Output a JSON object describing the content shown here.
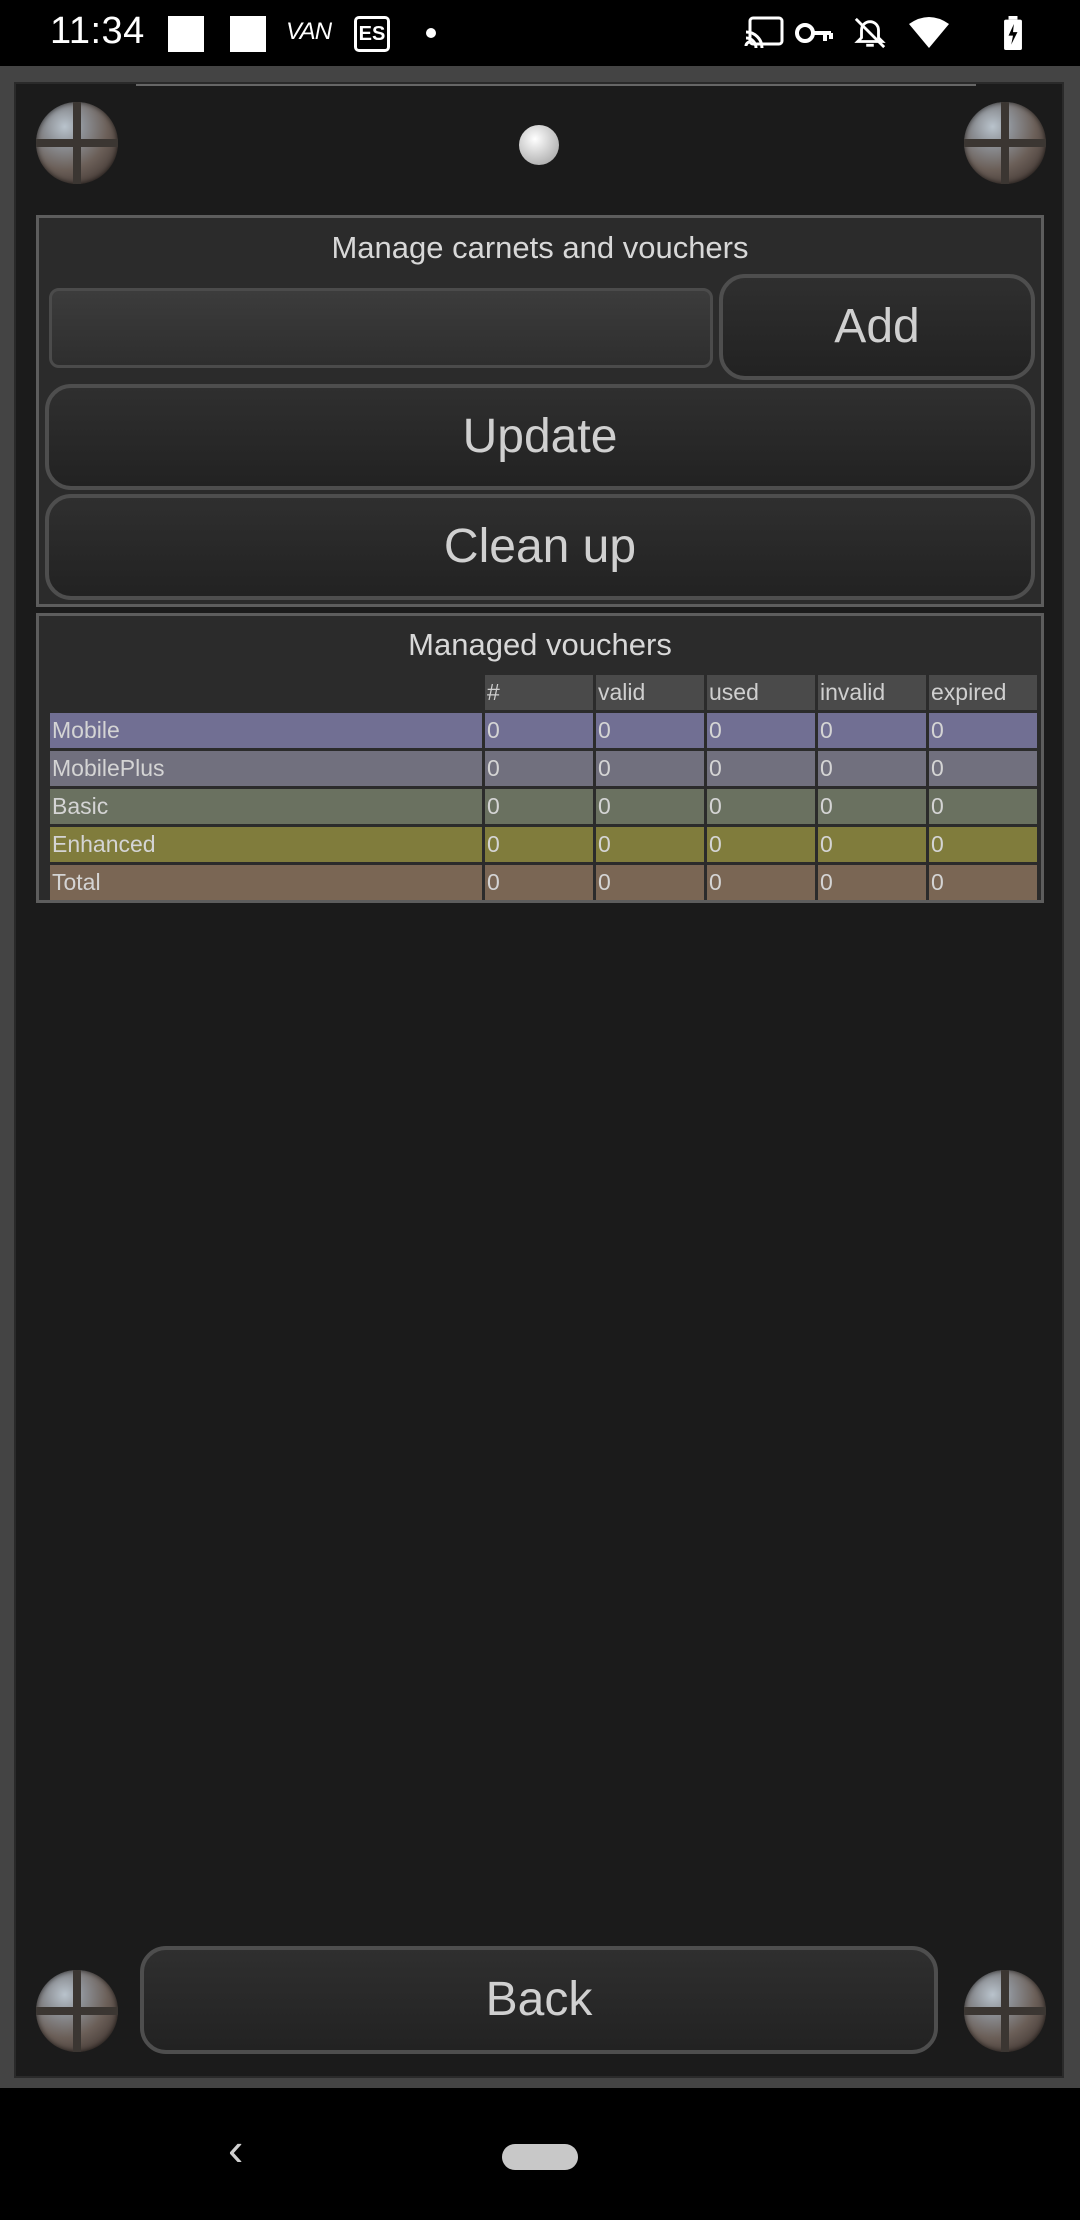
{
  "status_bar": {
    "time": "11:34",
    "carrier_label": "VAN",
    "es_badge": "ES",
    "icons": [
      "square-icon",
      "square-icon",
      "van-icon",
      "es-icon",
      "dot-icon",
      "cast-icon",
      "vpn-key-icon",
      "alarm-off-icon",
      "wifi-icon",
      "battery-charging-icon"
    ]
  },
  "manage": {
    "title": "Manage carnets and vouchers",
    "input_value": "",
    "input_placeholder": "",
    "add_label": "Add",
    "update_label": "Update",
    "cleanup_label": "Clean up"
  },
  "vouchers": {
    "title": "Managed vouchers",
    "columns": [
      "#",
      "valid",
      "used",
      "invalid",
      "expired"
    ],
    "rows": [
      {
        "name": "Mobile",
        "values": [
          "0",
          "0",
          "0",
          "0",
          "0"
        ],
        "color": "#716f93"
      },
      {
        "name": "MobilePlus",
        "values": [
          "0",
          "0",
          "0",
          "0",
          "0"
        ],
        "color": "#71707e"
      },
      {
        "name": "Basic",
        "values": [
          "0",
          "0",
          "0",
          "0",
          "0"
        ],
        "color": "#6a7160"
      },
      {
        "name": "Enhanced",
        "values": [
          "0",
          "0",
          "0",
          "0",
          "0"
        ],
        "color": "#807c3c"
      },
      {
        "name": "Total",
        "values": [
          "0",
          "0",
          "0",
          "0",
          "0"
        ],
        "color": "#7a6654"
      }
    ]
  },
  "footer": {
    "back_label": "Back"
  },
  "nav_bar": {
    "back_glyph": "‹"
  }
}
